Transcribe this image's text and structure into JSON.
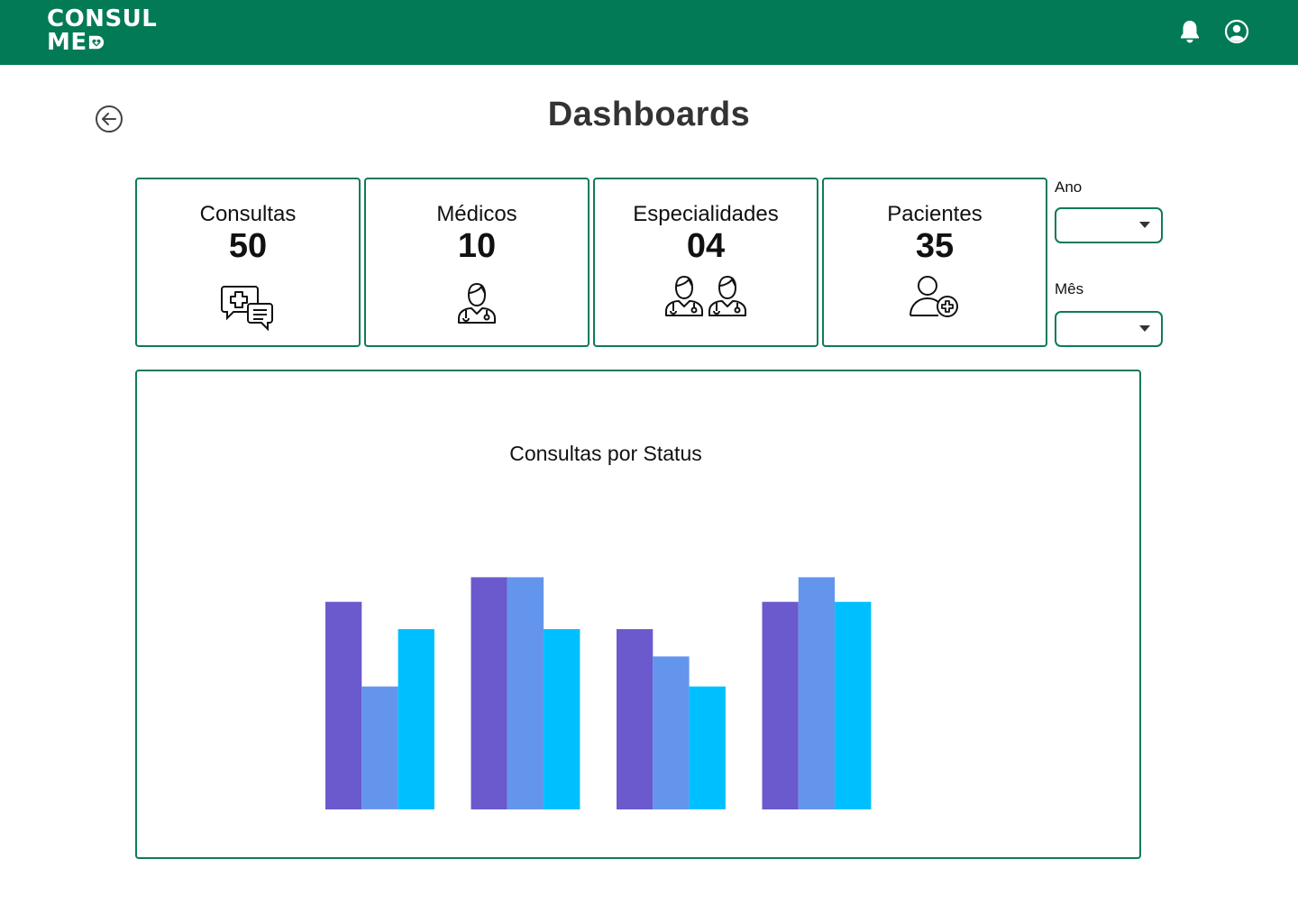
{
  "app": {
    "logo_line1": "CONSUL",
    "logo_line2": "ME",
    "accent_color": "#027A56"
  },
  "header": {
    "notification_icon": "bell-icon",
    "profile_icon": "user-circle-icon"
  },
  "page": {
    "title": "Dashboards",
    "back_icon": "arrow-left-circle-icon"
  },
  "cards": [
    {
      "label": "Consultas",
      "value": "50",
      "icon": "medical-chat-icon"
    },
    {
      "label": "Médicos",
      "value": "10",
      "icon": "doctor-icon"
    },
    {
      "label": "Especialidades",
      "value": "04",
      "icon": "doctors-icon"
    },
    {
      "label": "Pacientes",
      "value": "35",
      "icon": "add-patient-icon"
    }
  ],
  "filters": {
    "year_label": "Ano",
    "year_value": "",
    "month_label": "Mês",
    "month_value": ""
  },
  "chart_data": {
    "type": "bar",
    "title": "Consultas por Status",
    "categories": [
      "",
      "",
      "",
      ""
    ],
    "series": [
      {
        "values": [
          76,
          85,
          66,
          76
        ],
        "color": "#6A5ACD"
      },
      {
        "values": [
          45,
          85,
          56,
          85
        ],
        "color": "#6495ED"
      },
      {
        "values": [
          66,
          66,
          45,
          76
        ],
        "color": "#00BFFF"
      }
    ],
    "ylim": [
      0,
      100
    ],
    "grid": false,
    "legend": "none"
  }
}
